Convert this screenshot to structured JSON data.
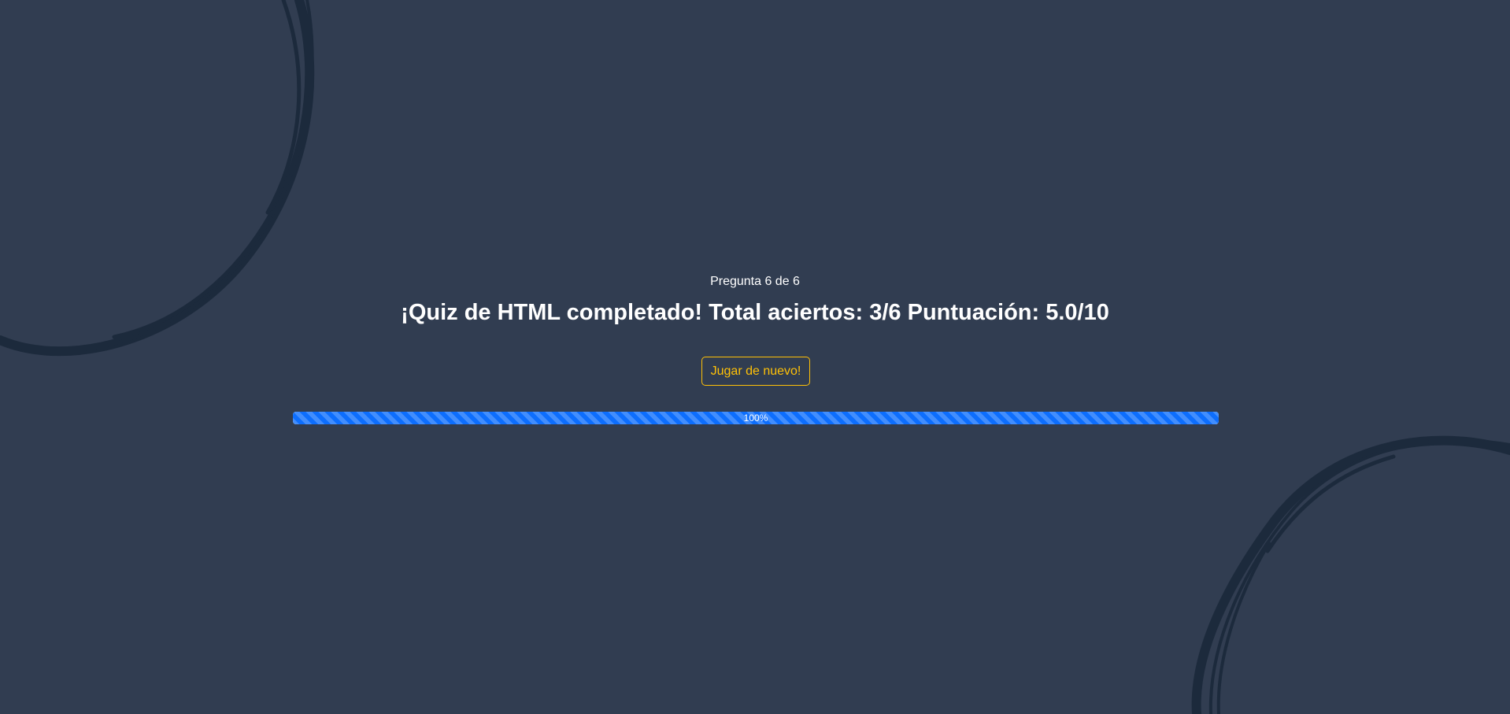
{
  "quiz": {
    "counter": "Pregunta 6 de 6",
    "result": "¡Quiz de HTML completado! Total aciertos: 3/6 Puntuación: 5.0/10",
    "play_again_label": "Jugar de nuevo!"
  },
  "progress": {
    "value": 100,
    "label": "100%"
  },
  "colors": {
    "background": "#313d51",
    "decoration": "#1c2a3c",
    "accent": "#ffc107",
    "progress_fill": "#0d6efd"
  }
}
